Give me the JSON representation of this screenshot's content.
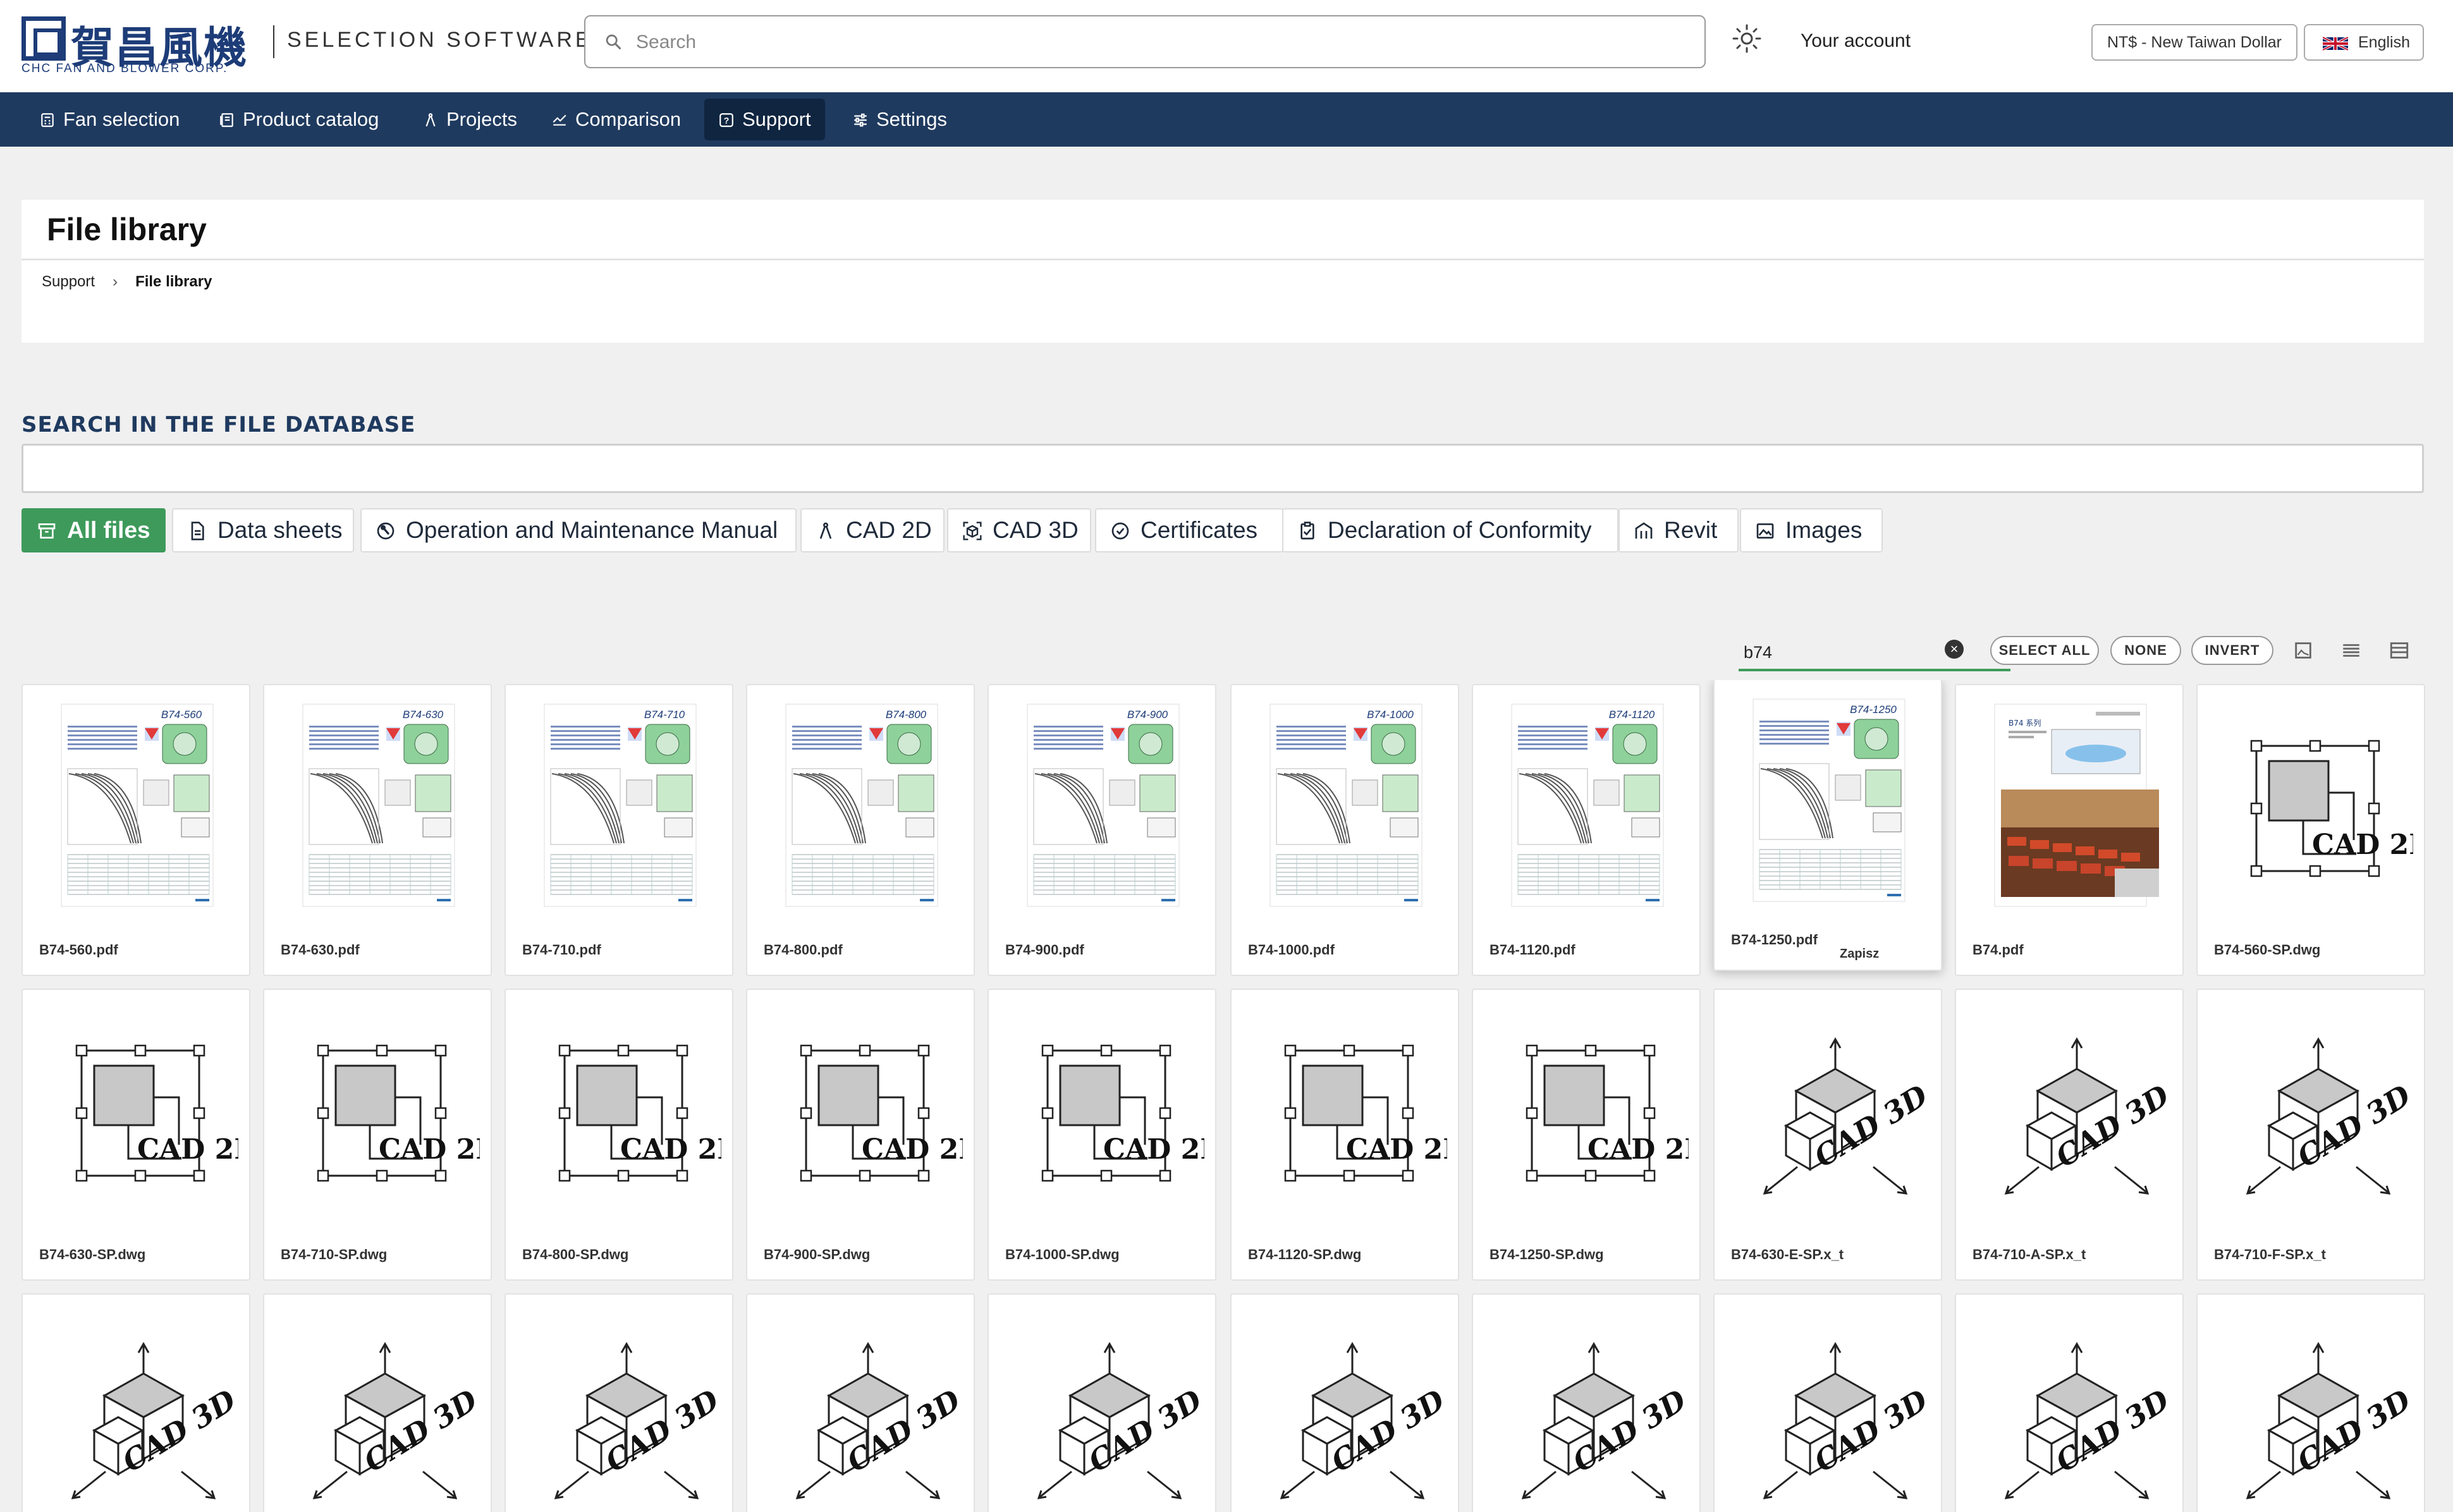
{
  "header": {
    "logo_cjk": "賀昌風機",
    "logo_en": "CHC FAN AND BLOWER CORP.",
    "brand_text": "SELECTION SOFTWARE",
    "search_placeholder": "Search",
    "theme_icon": "sun-icon",
    "account_label": "Your account",
    "currency_label": "NT$ - New Taiwan Dollar",
    "language_label": "English"
  },
  "nav": {
    "fan_selection": "Fan selection",
    "product_catalog": "Product catalog",
    "projects": "Projects",
    "comparison": "Comparison",
    "support": "Support",
    "settings": "Settings",
    "active": "support"
  },
  "page": {
    "title": "File library",
    "breadcrumb_root": "Support",
    "breadcrumb_current": "File library"
  },
  "search_db": {
    "heading": "SEARCH IN THE FILE DATABASE",
    "value": ""
  },
  "filters": {
    "all": "All files",
    "data_sheets": "Data sheets",
    "manual": "Operation and Maintenance Manual",
    "cad2d": "CAD 2D",
    "cad3d": "CAD 3D",
    "certificates": "Certificates",
    "doc": "Declaration of Conformity",
    "revit": "Revit",
    "images": "Images",
    "active": "all"
  },
  "toolbar": {
    "filter_value": "b74",
    "select_all": "SELECT ALL",
    "none": "NONE",
    "invert": "INVERT"
  },
  "colors": {
    "nav_bg": "#1f3a5f",
    "accent_green": "#3e9a5b",
    "brand_blue": "#1d3c78"
  },
  "files": [
    {
      "name": "B74-560.pdf",
      "type": "datasheet",
      "thumb_title": "B74-560"
    },
    {
      "name": "B74-630.pdf",
      "type": "datasheet",
      "thumb_title": "B74-630"
    },
    {
      "name": "B74-710.pdf",
      "type": "datasheet",
      "thumb_title": "B74-710"
    },
    {
      "name": "B74-800.pdf",
      "type": "datasheet",
      "thumb_title": "B74-800"
    },
    {
      "name": "B74-900.pdf",
      "type": "datasheet",
      "thumb_title": "B74-900"
    },
    {
      "name": "B74-1000.pdf",
      "type": "datasheet",
      "thumb_title": "B74-1000"
    },
    {
      "name": "B74-1120.pdf",
      "type": "datasheet",
      "thumb_title": "B74-1120"
    },
    {
      "name": "B74-1250.pdf",
      "type": "datasheet",
      "thumb_title": "B74-1250",
      "hover_label": "Zapisz"
    },
    {
      "name": "B74.pdf",
      "type": "brochure",
      "thumb_title": "B74 系列"
    },
    {
      "name": "B74-560-SP.dwg",
      "type": "cad2d"
    },
    {
      "name": "B74-630-SP.dwg",
      "type": "cad2d"
    },
    {
      "name": "B74-710-SP.dwg",
      "type": "cad2d"
    },
    {
      "name": "B74-800-SP.dwg",
      "type": "cad2d"
    },
    {
      "name": "B74-900-SP.dwg",
      "type": "cad2d"
    },
    {
      "name": "B74-1000-SP.dwg",
      "type": "cad2d"
    },
    {
      "name": "B74-1120-SP.dwg",
      "type": "cad2d"
    },
    {
      "name": "B74-1250-SP.dwg",
      "type": "cad2d"
    },
    {
      "name": "B74-630-E-SP.x_t",
      "type": "cad3d"
    },
    {
      "name": "B74-710-A-SP.x_t",
      "type": "cad3d"
    },
    {
      "name": "B74-710-F-SP.x_t",
      "type": "cad3d"
    },
    {
      "name": "",
      "type": "cad3d"
    },
    {
      "name": "",
      "type": "cad3d"
    },
    {
      "name": "",
      "type": "cad3d"
    },
    {
      "name": "",
      "type": "cad3d"
    },
    {
      "name": "",
      "type": "cad3d"
    },
    {
      "name": "",
      "type": "cad3d"
    },
    {
      "name": "",
      "type": "cad3d"
    },
    {
      "name": "",
      "type": "cad3d"
    },
    {
      "name": "",
      "type": "cad3d"
    },
    {
      "name": "",
      "type": "cad3d"
    }
  ],
  "thumb_labels": {
    "cad2d": "CAD 2D",
    "cad3d": "CAD 3D"
  }
}
